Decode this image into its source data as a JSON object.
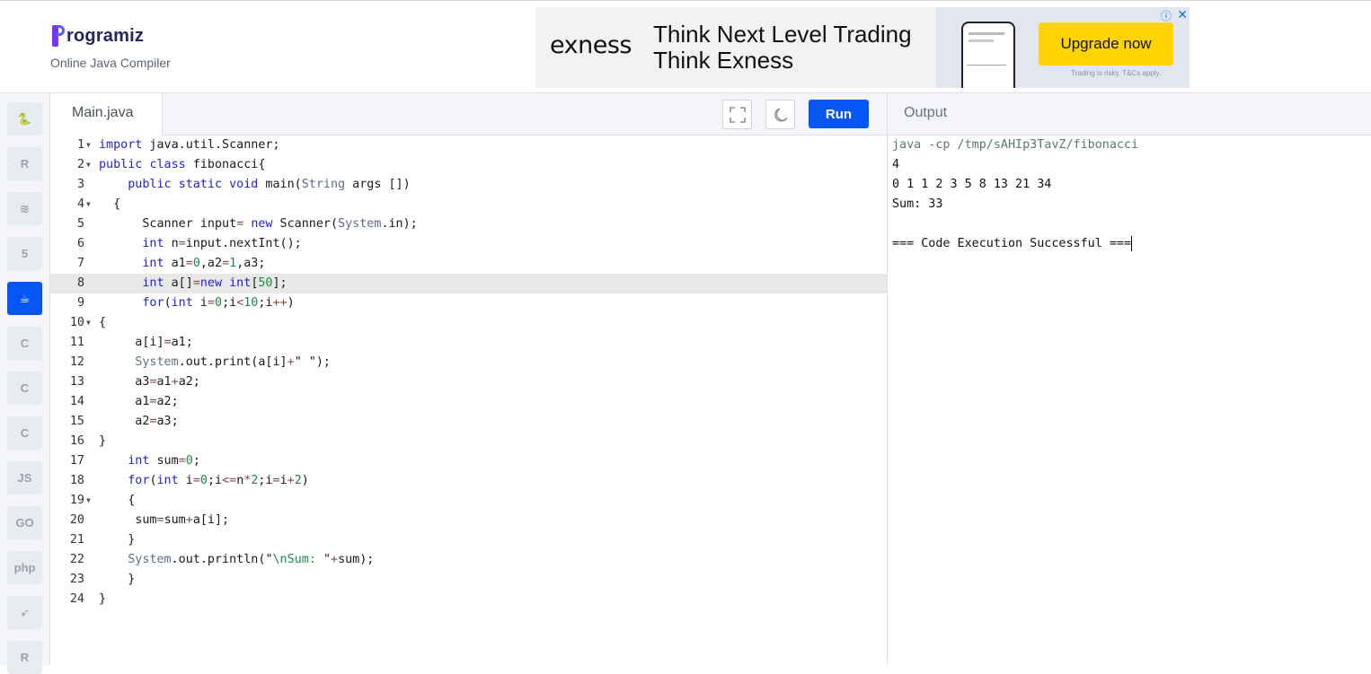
{
  "header": {
    "logo_text": "rogramiz",
    "subtitle": "Online Java Compiler"
  },
  "ad": {
    "brand": "exness",
    "headline_1": "Think Next Level Trading",
    "headline_2": "Think Exness",
    "cta": "Upgrade now",
    "disclaimer": "Trading is risky. T&Cs apply."
  },
  "sidebar": {
    "languages": [
      {
        "name": "python-icon",
        "glyph": "🐍",
        "active": false
      },
      {
        "name": "r-icon",
        "glyph": "R",
        "active": false
      },
      {
        "name": "sql-icon",
        "glyph": "≋",
        "active": false
      },
      {
        "name": "html5-icon",
        "glyph": "5",
        "active": false
      },
      {
        "name": "java-icon",
        "glyph": "☕",
        "active": true
      },
      {
        "name": "c-icon",
        "glyph": "C",
        "active": false
      },
      {
        "name": "cpp-icon",
        "glyph": "C",
        "active": false
      },
      {
        "name": "csharp-icon",
        "glyph": "C",
        "active": false
      },
      {
        "name": "javascript-icon",
        "glyph": "JS",
        "active": false
      },
      {
        "name": "go-icon",
        "glyph": "GO",
        "active": false
      },
      {
        "name": "php-icon",
        "glyph": "php",
        "active": false
      },
      {
        "name": "swift-icon",
        "glyph": "➶",
        "active": false
      },
      {
        "name": "rust-icon",
        "glyph": "R",
        "active": false
      }
    ]
  },
  "editor": {
    "tab_label": "Main.java",
    "run_label": "Run",
    "highlighted_line": 8,
    "lines": [
      {
        "n": "1",
        "fold": true,
        "html": "<span class=\"kw\">import</span> java.util.Scanner;"
      },
      {
        "n": "2",
        "fold": true,
        "html": "<span class=\"kw\">public</span> <span class=\"kw\">class</span> fibonacci{"
      },
      {
        "n": "3",
        "fold": false,
        "html": "    <span class=\"kw\">public</span> <span class=\"kw\">static</span> <span class=\"kw\">void</span> main(<span class=\"cls\">String</span> args [])"
      },
      {
        "n": "4",
        "fold": true,
        "html": "  {"
      },
      {
        "n": "5",
        "fold": false,
        "html": "      Scanner input<span class=\"op\">=</span> <span class=\"kw\">new</span> Scanner(<span class=\"cls\">System</span>.in);"
      },
      {
        "n": "6",
        "fold": false,
        "html": "      <span class=\"kw\">int</span> n<span class=\"op\">=</span>input.nextInt();"
      },
      {
        "n": "7",
        "fold": false,
        "html": "      <span class=\"kw\">int</span> a1<span class=\"op\">=</span><span class=\"num\">0</span>,a2<span class=\"op\">=</span><span class=\"num\">1</span>,a3;"
      },
      {
        "n": "8",
        "fold": false,
        "html": "      <span class=\"kw\">int</span> a[]<span class=\"op\">=</span><span class=\"kw\">new</span> <span class=\"kw\">int</span>[<span class=\"num\">50</span>];"
      },
      {
        "n": "9",
        "fold": false,
        "html": "      <span class=\"kw\">for</span>(<span class=\"kw\">int</span> i<span class=\"op\">=</span><span class=\"num\">0</span>;i<span class=\"op\">&lt;</span><span class=\"num\">10</span>;i<span class=\"op\">++</span>)"
      },
      {
        "n": "10",
        "fold": true,
        "html": "{"
      },
      {
        "n": "11",
        "fold": false,
        "html": "     a[i]<span class=\"op\">=</span>a1;"
      },
      {
        "n": "12",
        "fold": false,
        "html": "     <span class=\"cls\">System</span>.out.print(a[i]<span class=\"op\">+</span><span class=\"str\">\" \"</span>);"
      },
      {
        "n": "13",
        "fold": false,
        "html": "     a3<span class=\"op\">=</span>a1<span class=\"op\">+</span>a2;"
      },
      {
        "n": "14",
        "fold": false,
        "html": "     a1<span class=\"op\">=</span>a2;"
      },
      {
        "n": "15",
        "fold": false,
        "html": "     a2<span class=\"op\">=</span>a3;"
      },
      {
        "n": "16",
        "fold": false,
        "html": "}"
      },
      {
        "n": "17",
        "fold": false,
        "html": "    <span class=\"kw\">int</span> sum<span class=\"op\">=</span><span class=\"num\">0</span>;"
      },
      {
        "n": "18",
        "fold": false,
        "html": "    <span class=\"kw\">for</span>(<span class=\"kw\">int</span> i<span class=\"op\">=</span><span class=\"num\">0</span>;i<span class=\"op\">&lt;=</span>n<span class=\"op\">*</span><span class=\"num\">2</span>;i<span class=\"op\">=</span>i<span class=\"op\">+</span><span class=\"num\">2</span>)"
      },
      {
        "n": "19",
        "fold": true,
        "html": "    {"
      },
      {
        "n": "20",
        "fold": false,
        "html": "     sum<span class=\"op\">=</span>sum<span class=\"op\">+</span>a[i];"
      },
      {
        "n": "21",
        "fold": false,
        "html": "    }"
      },
      {
        "n": "22",
        "fold": false,
        "html": "    <span class=\"cls\">System</span>.out.println(<span class=\"str\">\"</span><span class=\"esc\">\\nSum: </span><span class=\"str\">\"</span><span class=\"op\">+</span>sum);"
      },
      {
        "n": "23",
        "fold": false,
        "html": "    }"
      },
      {
        "n": "24",
        "fold": false,
        "html": "}"
      }
    ]
  },
  "output": {
    "title": "Output",
    "lines": [
      {
        "text": "java -cp /tmp/sAHIp3TavZ/fibonacci",
        "cmd": true
      },
      {
        "text": "4",
        "cmd": false
      },
      {
        "text": "0 1 1 2 3 5 8 13 21 34",
        "cmd": false
      },
      {
        "text": "Sum: 33",
        "cmd": false
      },
      {
        "text": "",
        "cmd": false
      },
      {
        "text": "=== Code Execution Successful ===",
        "cmd": false
      }
    ]
  }
}
